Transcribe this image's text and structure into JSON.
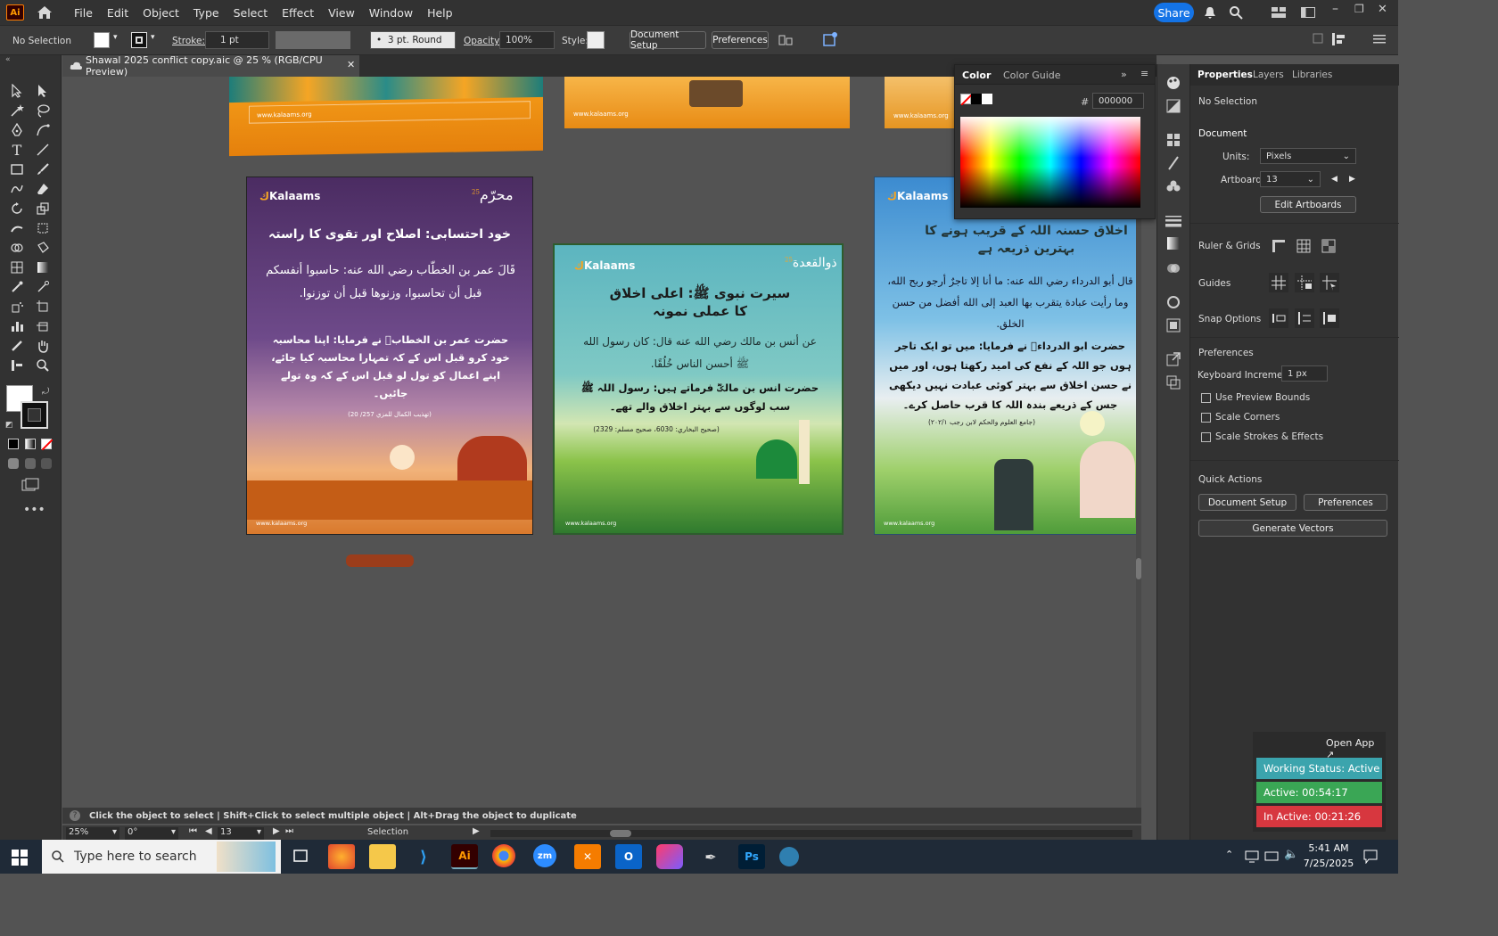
{
  "app": {
    "logo": "Ai",
    "menus": [
      "File",
      "Edit",
      "Object",
      "Type",
      "Select",
      "Effect",
      "View",
      "Window",
      "Help"
    ],
    "share_label": "Share"
  },
  "control_bar": {
    "selection": "No Selection",
    "stroke_label": "Stroke:",
    "stroke_value": "1 pt",
    "brush": "3 pt. Round",
    "opacity_label": "Opacity:",
    "opacity_value": "100%",
    "style_label": "Style:",
    "document_setup": "Document Setup",
    "preferences": "Preferences"
  },
  "document_tab": {
    "title": "Shawal 2025 conflict copy.aic @ 25 % (RGB/CPU Preview)"
  },
  "artboards": {
    "top_left_url": "www.kalaams.org",
    "top_mid_url": "www.kalaams.org",
    "top_right_url": "www.kalaams.org",
    "a1": {
      "brand": "Kalaams",
      "badge": "محرّم",
      "badge_year": "25",
      "heading": "خود احتسابی: اصلاح اور تقوی کا راستہ",
      "arabic": "قَالَ عمر بن الخطّاب رضي الله عنه: حاسبوا أنفسكم قبل أن تحاسبوا، وزنوها قبل أن توزنوا.",
      "urdu": "حضرت عمر بن الخطابؓ نے فرمایا: اپنا محاسبہ خود کرو قبل اس کے کہ تمہارا محاسبہ کیا جائے، اپنے اعمال کو تول لو قبل اس کے کہ وہ تولے جائیں۔",
      "ref": "(تهذيب الكمال للمزي 257/ 20)",
      "url": "www.kalaams.org"
    },
    "a2": {
      "brand": "Kalaams",
      "badge": "ذوالقعدة",
      "badge_year": "25",
      "heading": "سیرت نبوی ﷺ: اعلی اخلاق کا عملی نمونہ",
      "arabic": "عن أنس بن مالك رضي الله عنه قال: كان رسول الله ﷺ أحسن الناس خُلُقًا.",
      "urdu": "حضرت انس بن مالکؓ فرماتے ہیں: رسول اللہ ﷺ سب لوگوں سے بہتر اخلاق والے تھے۔",
      "ref": "(صحيح البخاري: 6030، صحيح مسلم: 2329)",
      "url": "www.kalaams.org"
    },
    "a3": {
      "brand": "Kalaams",
      "heading": "اخلاق حسنہ اللہ کے قریب ہونے کا بہترین ذریعہ ہے",
      "arabic": "قال أبو الدرداء رضي الله عنه: ما أنا إلا تاجرٌ أرجو ربح الله، وما رأيت عبادة يتقرب بها العبد إلى الله أفضل من حسن الخلق.",
      "urdu": "حضرت ابو الدرداءؓ نے فرمایا: میں تو ایک تاجر ہوں جو اللہ کے نفع کی امید رکھتا ہوں، اور میں نے حسن اخلاق سے بہتر کوئی عبادت نہیں دیکھی جس کے ذریعے بندہ اللہ کا قرب حاصل کرے۔",
      "ref": "(جامع العلوم والحكم لابن رجب ٢٠٢/١)",
      "url": "www.kalaams.org"
    }
  },
  "status": {
    "hint": "Click the object to select  |  Shift+Click to select multiple object  |  Alt+Drag the object to duplicate",
    "zoom": "25%",
    "rotation": "0°",
    "artboard": "13",
    "tool": "Selection"
  },
  "color_panel": {
    "tab_color": "Color",
    "tab_guide": "Color Guide",
    "hex_label": "#",
    "hex_value": "000000"
  },
  "properties": {
    "tabs": [
      "Properties",
      "Layers",
      "Libraries"
    ],
    "no_selection": "No Selection",
    "document": "Document",
    "units_label": "Units:",
    "units_value": "Pixels",
    "artboard_label": "Artboard:",
    "artboard_value": "13",
    "edit_artboards": "Edit Artboards",
    "ruler_grids": "Ruler & Grids",
    "guides": "Guides",
    "snap_options": "Snap Options",
    "preferences": "Preferences",
    "keyboard_increment_label": "Keyboard Increment:",
    "keyboard_increment_value": "1 px",
    "checks": [
      "Use Preview Bounds",
      "Scale Corners",
      "Scale Strokes & Effects"
    ],
    "quick_actions": "Quick Actions",
    "qa_document_setup": "Document Setup",
    "qa_preferences": "Preferences",
    "qa_generate_vectors": "Generate Vectors"
  },
  "tracker": {
    "open_app": "Open App ↗",
    "working": "Working Status: Active",
    "active": "Active: 00:54:17",
    "inactive": "In Active: 00:21:26"
  },
  "taskbar": {
    "search_placeholder": "Type here to search",
    "time": "5:41 AM",
    "date": "7/25/2025"
  },
  "colors": {
    "accent": "#1473e6",
    "working": "#3ba4ad",
    "active": "#3aa655",
    "inactive": "#d7373f"
  }
}
